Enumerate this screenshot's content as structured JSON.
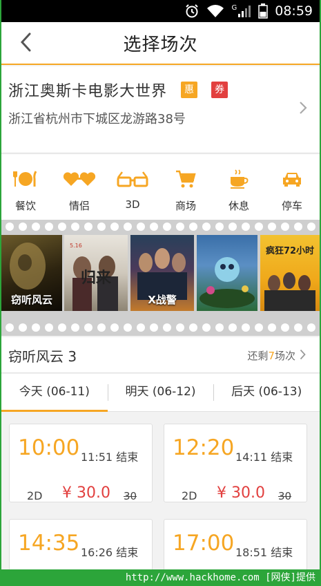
{
  "status_bar": {
    "time": "08:59",
    "network": "G",
    "icons": [
      "alarm-icon",
      "wifi-icon",
      "signal-icon",
      "battery-icon"
    ]
  },
  "header": {
    "title": "选择场次",
    "back_icon": "chevron-left-icon"
  },
  "cinema": {
    "name": "浙江奥斯卡电影大世界",
    "badge_discount": "惠",
    "badge_coupon": "券",
    "address": "浙江省杭州市下城区龙游路38号",
    "colors": {
      "discount": "#f6a623",
      "coupon": "#e2403f"
    }
  },
  "facilities": [
    {
      "label": "餐饮",
      "icon": "dining-icon"
    },
    {
      "label": "情侣",
      "icon": "couple-hearts-icon"
    },
    {
      "label": "3D",
      "icon": "3d-glasses-icon"
    },
    {
      "label": "商场",
      "icon": "shopping-cart-icon"
    },
    {
      "label": "休息",
      "icon": "coffee-cup-icon"
    },
    {
      "label": "停车",
      "icon": "car-icon"
    }
  ],
  "posters": [
    {
      "title": "窃听风云"
    },
    {
      "title": "归来"
    },
    {
      "title": "X战警"
    },
    {
      "title": ""
    },
    {
      "title": "疯狂72小时"
    }
  ],
  "movie": {
    "title": "窃听风云 3",
    "remaining_prefix": "还剩",
    "remaining_count": "7",
    "remaining_suffix": "场次"
  },
  "tabs": [
    {
      "label": "今天 (06-11)",
      "active": true
    },
    {
      "label": "明天 (06-12)",
      "active": false
    },
    {
      "label": "后天 (06-13)",
      "active": false
    }
  ],
  "showtimes": [
    {
      "start": "10:00",
      "end": "11:51 结束",
      "dimension": "2D",
      "price": "¥ 30.0",
      "original_price": "30"
    },
    {
      "start": "12:20",
      "end": "14:11 结束",
      "dimension": "2D",
      "price": "¥ 30.0",
      "original_price": "30"
    },
    {
      "start": "14:35",
      "end": "16:26 结束",
      "dimension": "",
      "price": "",
      "original_price": ""
    },
    {
      "start": "17:00",
      "end": "18:51 结束",
      "dimension": "",
      "price": "",
      "original_price": ""
    }
  ],
  "watermark": "http://www.hackhome.com [网侠]提供",
  "colors": {
    "accent": "#f6a623",
    "price": "#e2403f",
    "frame": "#2ca53a"
  }
}
